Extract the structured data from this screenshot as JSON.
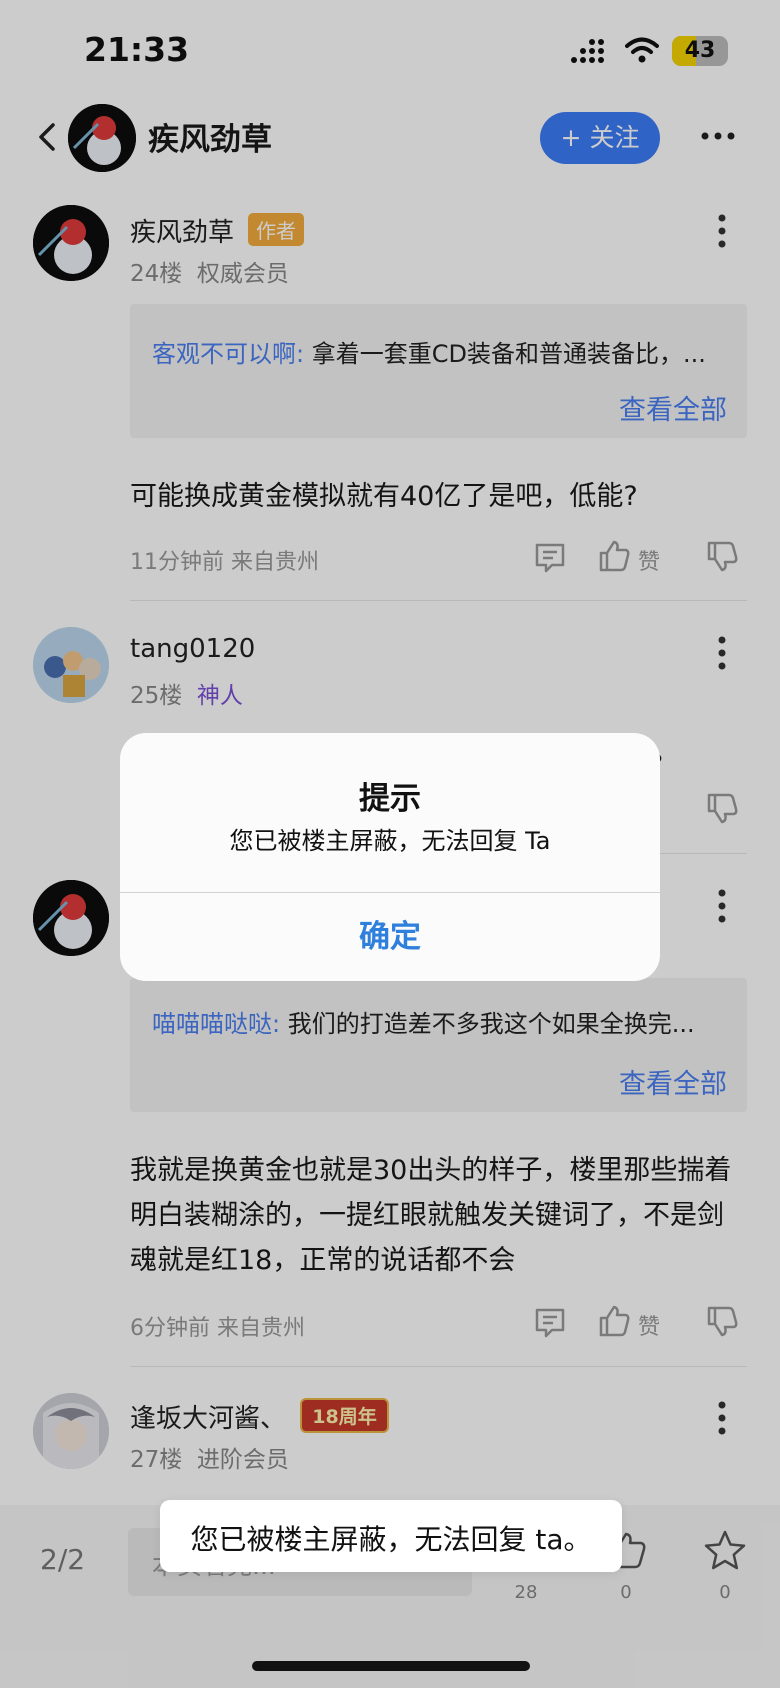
{
  "status_bar": {
    "time": "21:33",
    "battery_level": "43",
    "battery_fraction": 0.43
  },
  "header": {
    "title": "疾风劲草",
    "follow_label": "+ 关注"
  },
  "posts": [
    {
      "author": "疾风劲草",
      "author_tag": "作者",
      "floor": "24楼",
      "rank": "权威会员",
      "quote_user": "客观不可以啊:",
      "quote_text": "拿着一套重CD装备和普通装备比，...",
      "view_all": "查看全部",
      "body": "可能换成黄金模拟就有40亿了是吧，低能?",
      "time": "11分钟前 来自贵州",
      "like_label": "赞"
    },
    {
      "author": "tang0120",
      "floor": "25楼",
      "rank": "神人",
      "rank_color": "#7b4fd6",
      "partial_text": "。"
    },
    {
      "quote_user": "喵喵喵哒哒:",
      "quote_text": "我们的打造差不多我这个如果全换完...",
      "view_all": "查看全部",
      "body": "我就是换黄金也就是30出头的样子，楼里那些揣着明白装糊涂的，一提红眼就触发关键词了，不是剑魂就是红18，正常的说话都不会",
      "time": "6分钟前 来自贵州",
      "like_label": "赞"
    },
    {
      "author": "逢坂大河酱、",
      "badge": "18周年",
      "floor": "27楼",
      "rank": "进阶会员"
    }
  ],
  "dialog": {
    "title": "提示",
    "message": "您已被楼主屏蔽，无法回复 Ta",
    "confirm_label": "确定"
  },
  "bottom_bar": {
    "page_indicator": "2/2",
    "input_placeholder": "本页看完...",
    "comment_count": "28",
    "like_count": "0",
    "star_count": "0"
  },
  "toast": {
    "message": "您已被楼主屏蔽，无法回复 ta。"
  },
  "colors": {
    "accent": "#3b7cf7",
    "link": "#4a7ff0",
    "author_tag": "#f4ac3c",
    "dialog_button": "#2f7fdc"
  }
}
